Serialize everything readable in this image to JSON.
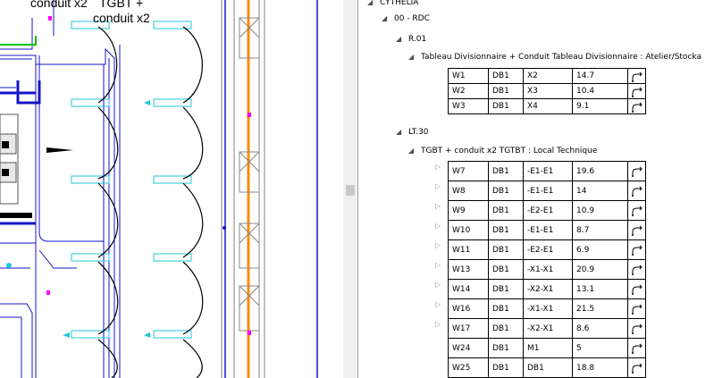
{
  "canvas": {
    "labels": {
      "conduit_x2": "conduit x2",
      "tgbt_line1": "TGBT +",
      "tgbt_line2": "conduit x2"
    },
    "colors": {
      "blue": "#1515c8",
      "cyan": "#22c7d8",
      "orange": "#ff8a00",
      "magenta": "#ff00ff",
      "green": "#00c000"
    }
  },
  "tree": {
    "root": "CYTHELIA",
    "level": "00 - RDC",
    "room1": {
      "name": "R.01",
      "group": "Tableau Divisionnaire + Conduit   Tableau Divisionnaire : Atelier/Stocka",
      "rows": [
        [
          "W1",
          "DB1",
          "X2",
          "14.7"
        ],
        [
          "W2",
          "DB1",
          "X3",
          "10.4"
        ],
        [
          "W3",
          "DB1",
          "X4",
          "9.1"
        ]
      ]
    },
    "room2": {
      "name": "LT.30",
      "group": "TGBT + conduit x2   TGTBT : Local Technique",
      "rows": [
        [
          "W7",
          "DB1",
          "-E1-E1",
          "19.6"
        ],
        [
          "W8",
          "DB1",
          "-E1-E1",
          "14"
        ],
        [
          "W9",
          "DB1",
          "-E2-E1",
          "10.9"
        ],
        [
          "W10",
          "DB1",
          "-E1-E1",
          "8.7"
        ],
        [
          "W11",
          "DB1",
          "-E2-E1",
          "6.9"
        ],
        [
          "W13",
          "DB1",
          "-X1-X1",
          "20.9"
        ],
        [
          "W14",
          "DB1",
          "-X2-X1",
          "13.1"
        ],
        [
          "W16",
          "DB1",
          "-X1-X1",
          "21.5"
        ],
        [
          "W17",
          "DB1",
          "-X2-X1",
          "8.6"
        ],
        [
          "W24",
          "DB1",
          "M1",
          "5"
        ],
        [
          "W25",
          "DB1",
          "DB1",
          "18.8"
        ]
      ],
      "expandable": [
        true,
        true,
        true,
        true,
        true,
        true,
        true,
        true,
        true,
        false,
        false
      ]
    },
    "icons": {
      "cable": "cable-bend-icon",
      "expanded": "triangle-down-icon",
      "collapsed": "triangle-right-icon"
    }
  }
}
